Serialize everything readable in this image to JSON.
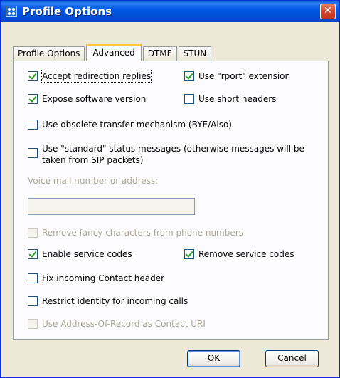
{
  "window": {
    "title": "Profile Options",
    "close_glyph": "✕"
  },
  "tabs": [
    "Profile Options",
    "Advanced",
    "DTMF",
    "STUN"
  ],
  "options": {
    "accept_redirection": {
      "label": "Accept redirection replies",
      "checked": true
    },
    "use_rport": {
      "label": "Use \"rport\" extension",
      "checked": true
    },
    "expose_version": {
      "label": "Expose software version",
      "checked": true
    },
    "short_headers": {
      "label": "Use short headers",
      "checked": false
    },
    "obsolete_transfer": {
      "label": "Use obsolete transfer mechanism (BYE/Also)",
      "checked": false
    },
    "standard_status": {
      "label": "Use \"standard\" status messages (otherwise messages will be taken from SIP packets)",
      "checked": false
    },
    "remove_fancy": {
      "label": "Remove fancy characters from phone numbers",
      "checked": false,
      "disabled": true
    },
    "enable_service_codes": {
      "label": "Enable service codes",
      "checked": true
    },
    "remove_service_codes": {
      "label": "Remove service codes",
      "checked": true
    },
    "fix_contact": {
      "label": "Fix incoming Contact header",
      "checked": false
    },
    "restrict_identity": {
      "label": "Restrict identity for incoming calls",
      "checked": false
    },
    "use_aor": {
      "label": "Use Address-Of-Record as Contact URI",
      "checked": false,
      "disabled": true
    }
  },
  "voicemail": {
    "label": "Voice mail number or address:",
    "value": ""
  },
  "buttons": {
    "ok": "OK",
    "cancel": "Cancel"
  },
  "colors": {
    "titlebar": "#0058e6",
    "dialog_bg": "#ece9d8",
    "tab_highlight": "#ffc83c",
    "check": "#21a121"
  }
}
